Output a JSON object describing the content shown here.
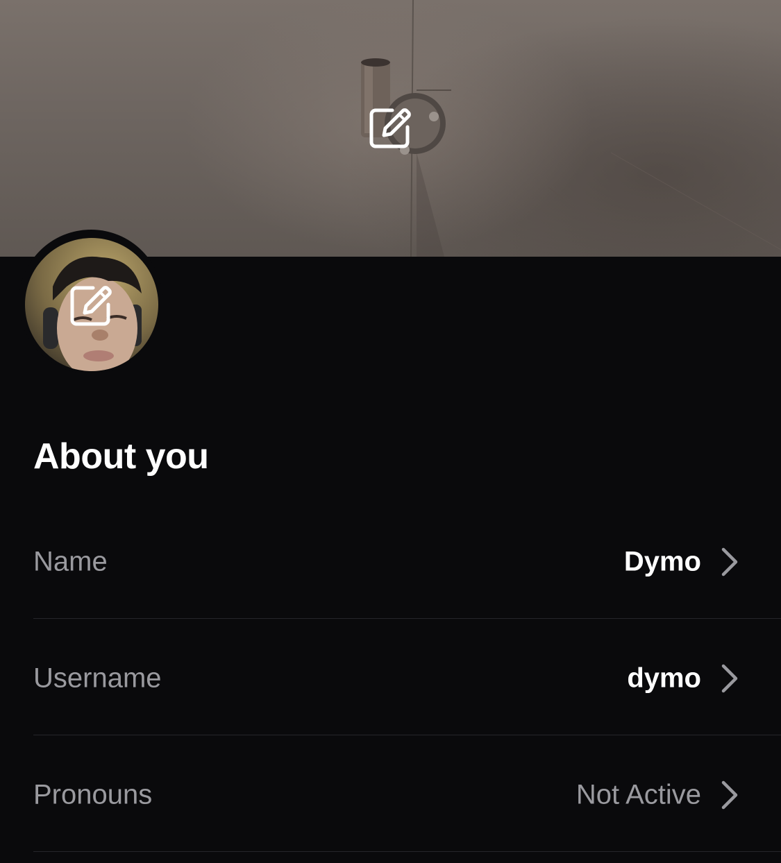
{
  "banner": {
    "edit_icon": "edit-square-icon"
  },
  "avatar": {
    "edit_icon": "edit-square-icon"
  },
  "section": {
    "title": "About you"
  },
  "rows": [
    {
      "label": "Name",
      "value": "Dymo",
      "muted": false,
      "icon": "chevron-right-icon"
    },
    {
      "label": "Username",
      "value": "dymo",
      "muted": false,
      "icon": "chevron-right-icon"
    },
    {
      "label": "Pronouns",
      "value": "Not Active",
      "muted": true,
      "icon": "chevron-right-icon"
    }
  ],
  "colors": {
    "background": "#0a0a0c",
    "label": "#9a9a9f",
    "value": "#ffffff",
    "divider": "#26262a"
  }
}
